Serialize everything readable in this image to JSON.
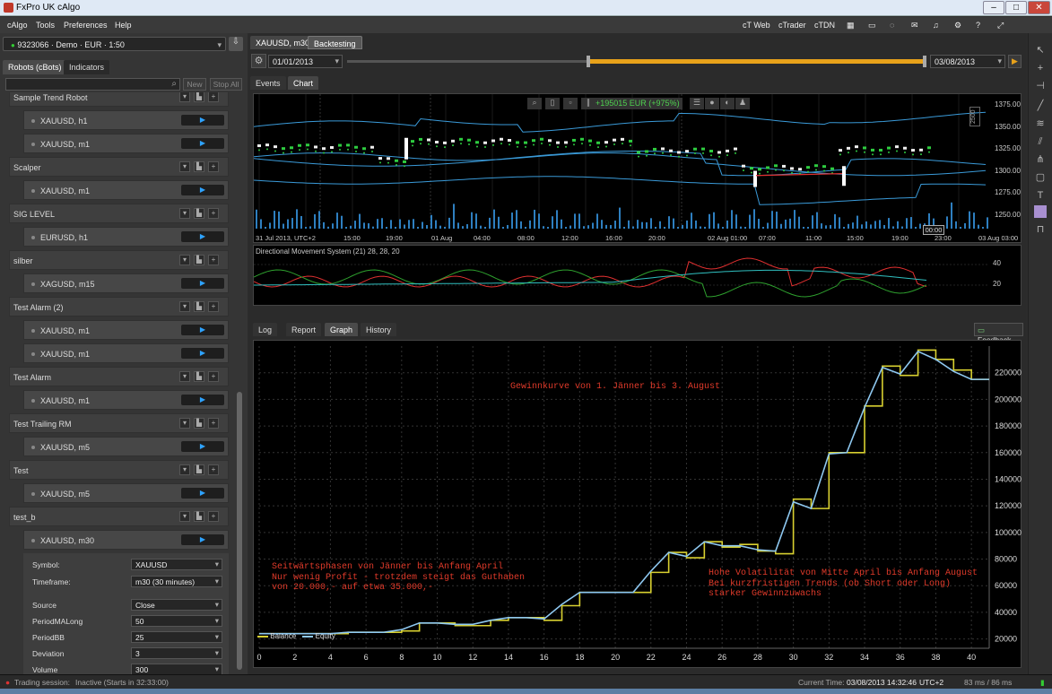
{
  "window": {
    "title": "FxPro UK cAlgo"
  },
  "menu": [
    "cAlgo",
    "Tools",
    "Preferences",
    "Help"
  ],
  "toplinks": [
    "cT Web",
    "cTrader",
    "cTDN"
  ],
  "account": {
    "label": "9323066 · Demo · EUR · 1:50"
  },
  "leftTabs": [
    "Robots (cBots)",
    "Indicators"
  ],
  "leftButtons": {
    "new": "New",
    "stop_all": "Stop All"
  },
  "robots": [
    {
      "type": "group",
      "label": "Sample Trend Robot"
    },
    {
      "type": "child",
      "label": "XAUUSD, h1"
    },
    {
      "type": "child",
      "label": "XAUUSD, m1"
    },
    {
      "type": "group",
      "label": "Scalper"
    },
    {
      "type": "child",
      "label": "XAUUSD, m1"
    },
    {
      "type": "group",
      "label": "SIG LEVEL"
    },
    {
      "type": "child",
      "label": "EURUSD, h1"
    },
    {
      "type": "group",
      "label": "silber"
    },
    {
      "type": "child",
      "label": "XAGUSD, m15"
    },
    {
      "type": "group",
      "label": "Test Alarm (2)"
    },
    {
      "type": "child",
      "label": "XAUUSD, m1"
    },
    {
      "type": "child",
      "label": "XAUUSD, m1"
    },
    {
      "type": "group",
      "label": "Test Alarm"
    },
    {
      "type": "child",
      "label": "XAUUSD, m1"
    },
    {
      "type": "group",
      "label": "Test Trailing RM"
    },
    {
      "type": "child",
      "label": "XAUUSD, m5"
    },
    {
      "type": "group",
      "label": "Test"
    },
    {
      "type": "child",
      "label": "XAUUSD, m5"
    },
    {
      "type": "group",
      "label": "test_b"
    },
    {
      "type": "child",
      "label": "XAUUSD, m30"
    }
  ],
  "params": {
    "symbol": {
      "label": "Symbol:",
      "value": "XAUUSD"
    },
    "timeframe": {
      "label": "Timeframe:",
      "value": "m30 (30 minutes)"
    },
    "list": [
      {
        "label": "Source",
        "value": "Close"
      },
      {
        "label": "PeriodMALong",
        "value": "50"
      },
      {
        "label": "PeriodBB",
        "value": "25"
      },
      {
        "label": "Deviation",
        "value": "3"
      },
      {
        "label": "Volume",
        "value": "300"
      }
    ]
  },
  "mainTabs": [
    "XAUUSD, m30",
    "Backtesting"
  ],
  "backtest": {
    "start": "01/01/2013",
    "end": "03/08/2013"
  },
  "subTabs": [
    "Events",
    "Chart"
  ],
  "chart": {
    "profit": "+195015 EUR (+975%)",
    "price_ticks": [
      "1375.00",
      "1350.00",
      "1325.00",
      "1300.00",
      "1275.00",
      "1250.00"
    ],
    "side_label": "2500",
    "time_ticks": [
      "31 Jul 2013, UTC+2",
      "15:00",
      "19:00",
      "01 Aug",
      "04:00",
      "08:00",
      "12:00",
      "16:00",
      "20:00",
      "02 Aug 01:00",
      "07:00",
      "11:00",
      "15:00",
      "19:00",
      "23:00",
      "03 Aug 03:00"
    ],
    "cursor_time": "00:00"
  },
  "indicator": {
    "title": "Directional Movement System (21) 28, 28, 20",
    "ticks": [
      "40",
      "20"
    ]
  },
  "bottomTabs": [
    "Log",
    "Report",
    "Graph",
    "History"
  ],
  "feedback": "Feedback",
  "chart_data": {
    "type": "line",
    "x_ticks": [
      0,
      2,
      4,
      6,
      8,
      10,
      12,
      14,
      16,
      18,
      20,
      22,
      24,
      26,
      28,
      30,
      32,
      34,
      36,
      38,
      40
    ],
    "y_ticks": [
      20000,
      40000,
      60000,
      80000,
      100000,
      120000,
      140000,
      160000,
      180000,
      200000,
      220000
    ],
    "xlim": [
      0,
      41
    ],
    "ylim": [
      13000,
      240000
    ],
    "colors": {
      "Balance": "#d8d030",
      "Equity": "#8ec8f0"
    },
    "legend_position": "bottom-left",
    "series": [
      {
        "name": "Balance",
        "x": [
          0,
          1,
          2,
          3,
          4,
          5,
          6,
          7,
          8,
          9,
          10,
          11,
          12,
          13,
          14,
          15,
          16,
          17,
          18,
          19,
          20,
          21,
          22,
          23,
          24,
          25,
          26,
          27,
          28,
          29,
          30,
          31,
          32,
          33,
          34,
          35,
          36,
          37,
          38,
          39,
          40,
          41
        ],
        "values": [
          24000,
          24000,
          24000,
          24000,
          24000,
          25000,
          25000,
          25000,
          26000,
          32000,
          32000,
          30000,
          30000,
          34000,
          36000,
          36000,
          34000,
          45000,
          55000,
          55000,
          55000,
          55000,
          70000,
          85000,
          81000,
          93000,
          89000,
          91000,
          86000,
          84000,
          125000,
          118000,
          160000,
          160000,
          195000,
          225000,
          218000,
          237000,
          230000,
          222000,
          215000,
          215000
        ]
      },
      {
        "name": "Equity",
        "x": [
          0,
          1,
          2,
          3,
          4,
          5,
          6,
          7,
          8,
          9,
          10,
          11,
          12,
          13,
          14,
          15,
          16,
          17,
          18,
          19,
          20,
          21,
          22,
          23,
          24,
          25,
          26,
          27,
          28,
          29,
          30,
          31,
          32,
          33,
          34,
          35,
          36,
          37,
          38,
          39,
          40,
          41
        ],
        "values": [
          24000,
          24000,
          24000,
          24000,
          24000,
          25000,
          25000,
          25000,
          27000,
          32000,
          32000,
          31000,
          31000,
          34000,
          36000,
          36000,
          35000,
          46000,
          55000,
          55000,
          55000,
          55000,
          71000,
          85000,
          82000,
          93000,
          90000,
          90000,
          87000,
          86000,
          123000,
          118000,
          159000,
          160000,
          194000,
          224000,
          219000,
          236000,
          230000,
          221000,
          215000,
          215000
        ]
      }
    ],
    "annotations": [
      {
        "text": "Gewinnkurve von 1. Jänner bis 3. August"
      },
      {
        "text": "Seitwärtsphasen von Jänner bis Anfang April\nNur wenig Profit - trotzdem steigt das Guthaben\nvon 20.000,- auf etwa 35.000,-"
      },
      {
        "text": "Hohe Volatilität von Mitte April bis Anfang August\nBei kurzfristigen Trends (ob Short oder Long)\nstarker Gewinnzuwachs"
      }
    ]
  },
  "status": {
    "session_label": "Trading session:",
    "session_value": "Inactive (Starts in 32:33:00)",
    "time_label": "Current Time:",
    "time_value": "03/08/2013 14:32:46",
    "tz": "UTC+2",
    "latency": "83 ms / 86 ms"
  }
}
